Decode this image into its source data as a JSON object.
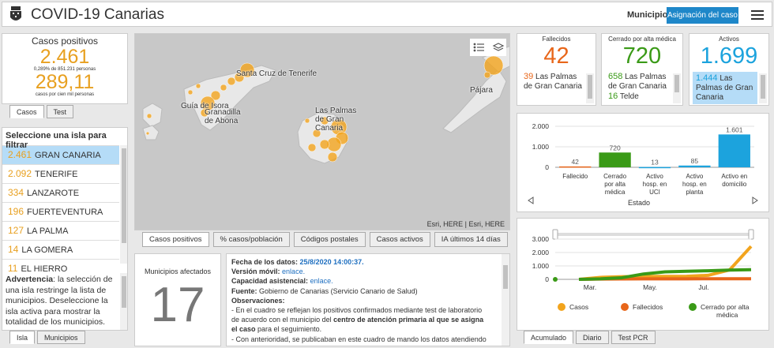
{
  "header": {
    "title": "COVID-19 Canarias",
    "municipio": "Municipio",
    "asignacion": "Asignación del caso"
  },
  "casos": {
    "label": "Casos positivos",
    "total": "2.461",
    "pct_line": "0,289% de 851.231 personas",
    "rate": "289,11",
    "rate_line": "casos por cien mil personas",
    "tabs": [
      "Casos",
      "Test"
    ]
  },
  "islas": {
    "header": "Seleccione una isla para filtrar",
    "items": [
      {
        "n": "2.461",
        "name": "GRAN CANARIA"
      },
      {
        "n": "2.092",
        "name": "TENERIFE"
      },
      {
        "n": "334",
        "name": "LANZAROTE"
      },
      {
        "n": "196",
        "name": "FUERTEVENTURA"
      },
      {
        "n": "127",
        "name": "LA PALMA"
      },
      {
        "n": "14",
        "name": "LA GOMERA"
      },
      {
        "n": "11",
        "name": "EL HIERRO"
      }
    ],
    "warning_bold": "Advertencia",
    "warning": ": la selección de una isla restringe la lista de municipios. Deseleccione la isla activa para mostrar la totalidad de los municipios.",
    "tabs": [
      "Isla",
      "Municipios"
    ]
  },
  "map": {
    "labels": [
      "Santa Cruz de Tenerife",
      "Guía de Isora",
      "Granadilla de Abona",
      "Las Palmas de Gran Canaria",
      "Pájara"
    ],
    "credit": "Esri, HERE | Esri, HERE",
    "tabs": [
      "Casos positivos",
      "% casos/población",
      "Códigos postales",
      "Casos activos",
      "IA últimos 14 días"
    ]
  },
  "municipios": {
    "label": "Municipios afectados",
    "value": "17"
  },
  "info": {
    "fecha_label": "Fecha de los datos:",
    "fecha": "25/8/2020 14:00:37.",
    "version_label": "Versión móvil:",
    "version_link": "enlace.",
    "capacidad_label": "Capacidad asistencial:",
    "capacidad_link": "enlace.",
    "fuente_label": "Fuente:",
    "fuente": "Gobierno de Canarias (Servicio Canario de Salud)",
    "obs_label": "Observaciones:",
    "obs1_a": "- En el cuadro se reflejan los positivos confirmados mediante test de laboratorio de acuerdo con el municipio del ",
    "obs1_b": "centro de atención primaria al que se asigna el caso",
    "obs1_c": " para el seguimiento.",
    "obs2": "- Con anterioridad, se publicaban en este cuadro de mando los datos atendiendo a"
  },
  "kpis": {
    "fallecidos": {
      "label": "Fallecidos",
      "value": "42",
      "sub_n": "39",
      "sub": "Las Palmas de Gran Canaria",
      "color": "#e8661a"
    },
    "cerrado": {
      "label": "Cerrado por alta médica",
      "value": "720",
      "sub_n": "658",
      "sub": "Las Palmas de Gran Canaria",
      "sub2_n": "16",
      "sub2": "Telde",
      "color": "#3a9a17"
    },
    "activos": {
      "label": "Activos",
      "value": "1.699",
      "sub_n": "1.444",
      "sub": "Las Palmas de Gran Canaria",
      "color": "#1ca3dd"
    }
  },
  "chart_data": [
    {
      "type": "bar",
      "categories": [
        "Fallecido",
        "Cerrado por alta médica",
        "Activo hosp. en UCI",
        "Activo hosp. en planta",
        "Activo en domicilio"
      ],
      "values": [
        42,
        720,
        13,
        85,
        1601
      ],
      "value_labels": [
        "42",
        "720",
        "13",
        "85",
        "1.601"
      ],
      "colors": [
        "#e8661a",
        "#3a9a17",
        "#1ca3dd",
        "#1ca3dd",
        "#1ca3dd"
      ],
      "xlabel": "Estado",
      "ylim": [
        0,
        2000
      ],
      "yticks": [
        "0",
        "1.000",
        "2.000"
      ]
    },
    {
      "type": "line",
      "x": [
        "Mar.",
        "May.",
        "Jul."
      ],
      "series": [
        {
          "name": "Casos",
          "color": "#f2a41d",
          "values": [
            0,
            150,
            200,
            210,
            220,
            230,
            300,
            700,
            2461
          ]
        },
        {
          "name": "Fallecidos",
          "color": "#e8661a",
          "values": [
            0,
            20,
            30,
            35,
            38,
            40,
            41,
            41,
            42
          ]
        },
        {
          "name": "Cerrado por alta médica",
          "color": "#3a9a17",
          "values": [
            0,
            40,
            120,
            400,
            560,
            600,
            640,
            690,
            720
          ]
        }
      ],
      "ylim": [
        0,
        3000
      ],
      "yticks": [
        "0",
        "1.000",
        "2.000",
        "3.000"
      ],
      "tabs": [
        "Acumulado",
        "Diario",
        "Test PCR"
      ]
    }
  ]
}
